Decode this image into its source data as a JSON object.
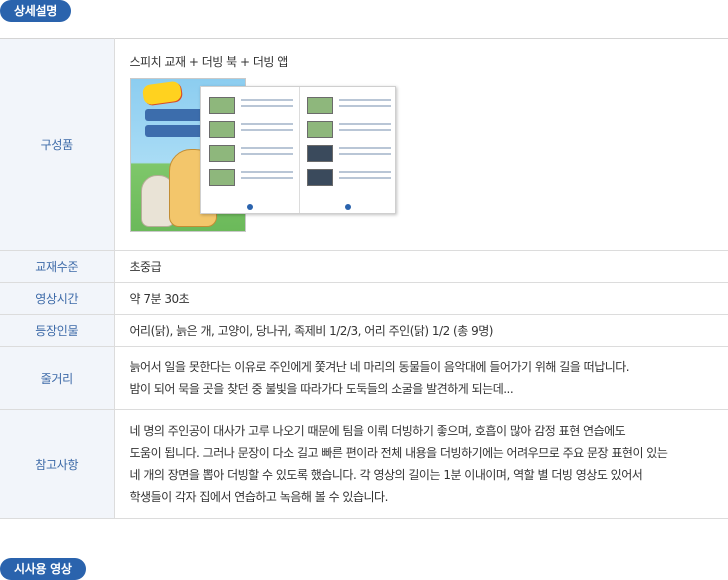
{
  "sections": {
    "detail_label": "상세설명",
    "preview_label": "시사용 영상"
  },
  "rows": {
    "composition": {
      "label": "구성품",
      "value": "스피치 교재 + 더빙 북 + 더빙 앱",
      "image_alt_icon": "book-image"
    },
    "level": {
      "label": "교재수준",
      "value": "초중급"
    },
    "duration": {
      "label": "영상시간",
      "value": "약 7분 30초"
    },
    "characters": {
      "label": "등장인물",
      "value": "어리(닭), 늙은 개, 고양이, 당나귀, 족제비 1/2/3, 어리 주인(닭) 1/2 (총 9명)"
    },
    "plot": {
      "label": "줄거리",
      "lines": [
        "늙어서 일을 못한다는 이유로 주인에게 쫓겨난 네 마리의 동물들이 음악대에 들어가기 위해 길을 떠납니다.",
        "밤이 되어 묵을 곳을 찾던 중 불빛을 따라가다 도둑들의 소굴을 발견하게 되는데..."
      ]
    },
    "notes": {
      "label": "참고사항",
      "lines": [
        "네 명의 주인공이 대사가 고루 나오기 때문에 팀을 이뤄 더빙하기 좋으며, 호흡이 많아 감정 표현 연습에도",
        "도움이 됩니다. 그러나 문장이 다소 길고 빠른 편이라 전체 내용을 더빙하기에는 어려우므로 주요 문장 표현이 있는",
        "네 개의 장면을 뽑아 더빙할 수 있도록 했습니다. 각 영상의 길이는 1분 이내이며, 역할 별 더빙 영상도 있어서",
        "학생들이 각자 집에서 연습하고 녹음해 볼 수 있습니다."
      ]
    }
  },
  "colors": {
    "accent": "#2a63ad",
    "header_bg": "#f2f5fa",
    "header_text": "#3d6aa8"
  }
}
